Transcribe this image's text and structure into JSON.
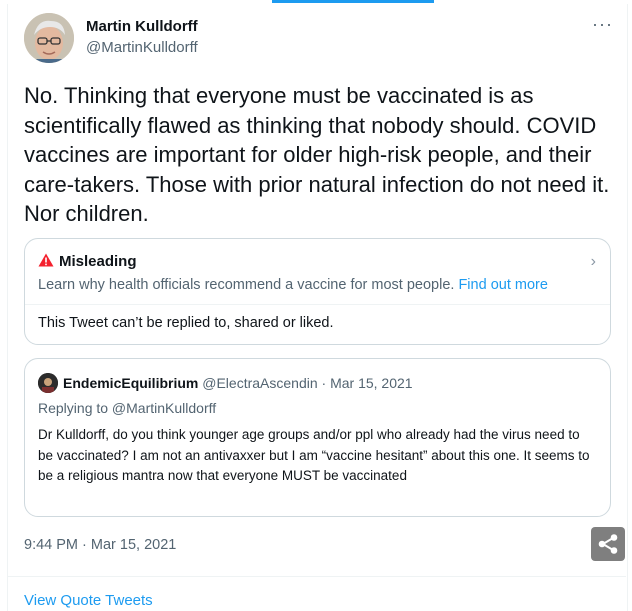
{
  "tweet": {
    "author_name": "Martin Kulldorff",
    "author_handle": "@MartinKulldorff",
    "more_label": "···",
    "text": "No. Thinking that everyone must be vaccinated is as scientifically flawed as thinking that nobody should. COVID vaccines are important for older high-risk people, and their care-takers. Those with prior natural infection do not need it. Nor children.",
    "timestamp": "9:44 PM · Mar 15, 2021"
  },
  "notice": {
    "title": "Misleading",
    "description": "Learn why health officials recommend a vaccine for most people.",
    "link_text": "Find out more",
    "restriction": "This Tweet can’t be replied to, shared or liked."
  },
  "quote": {
    "author_name": "EndemicEquilibrium",
    "author_handle": "@ElectraAscendin",
    "date": "· Mar 15, 2021",
    "replying_to": "Replying to @MartinKulldorff",
    "text": "Dr Kulldorff, do you think younger age groups and/or ppl who already had the virus need to be vaccinated? I am not an antivaxxer but I am “vaccine hesitant” about this one. It seems to be a religious mantra now that everyone MUST be vaccinated"
  },
  "footer": {
    "view_quotes": "View Quote Tweets"
  },
  "icons": {
    "warning": "warning-icon",
    "share": "share-icon",
    "chevron": "chevron-right-icon"
  },
  "colors": {
    "accent": "#1d9bf0",
    "warning": "#f4212e",
    "muted": "#536471",
    "border": "#cfd9de"
  }
}
